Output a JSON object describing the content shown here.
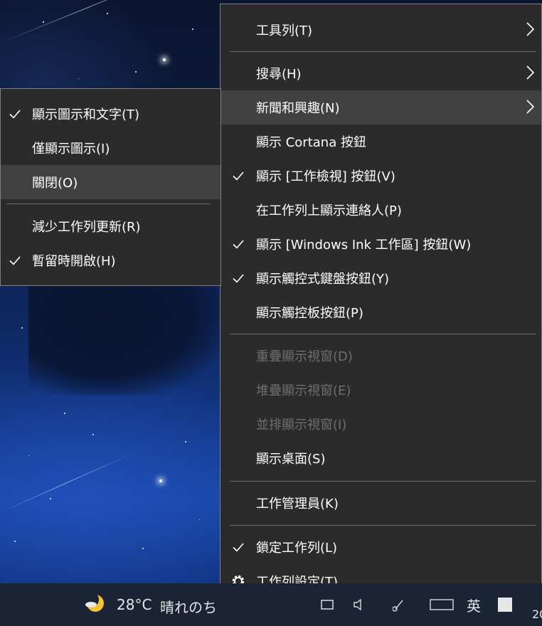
{
  "main_menu": {
    "items": [
      {
        "label": "工具列(T)",
        "checked": false,
        "submenu": true,
        "disabled": false,
        "highlight": false
      },
      {
        "label": "搜尋(H)",
        "checked": false,
        "submenu": true,
        "disabled": false,
        "highlight": false
      },
      {
        "label": "新聞和興趣(N)",
        "checked": false,
        "submenu": true,
        "disabled": false,
        "highlight": true
      },
      {
        "label": "顯示 Cortana 按鈕",
        "checked": false,
        "submenu": false,
        "disabled": false,
        "highlight": false
      },
      {
        "label": "顯示 [工作檢視] 按鈕(V)",
        "checked": true,
        "submenu": false,
        "disabled": false,
        "highlight": false
      },
      {
        "label": "在工作列上顯示連絡人(P)",
        "checked": false,
        "submenu": false,
        "disabled": false,
        "highlight": false
      },
      {
        "label": "顯示 [Windows Ink 工作區] 按鈕(W)",
        "checked": true,
        "submenu": false,
        "disabled": false,
        "highlight": false
      },
      {
        "label": "顯示觸控式鍵盤按鈕(Y)",
        "checked": true,
        "submenu": false,
        "disabled": false,
        "highlight": false
      },
      {
        "label": "顯示觸控板按鈕(P)",
        "checked": false,
        "submenu": false,
        "disabled": false,
        "highlight": false
      },
      {
        "label": "重疊顯示視窗(D)",
        "checked": false,
        "submenu": false,
        "disabled": true,
        "highlight": false
      },
      {
        "label": "堆疊顯示視窗(E)",
        "checked": false,
        "submenu": false,
        "disabled": true,
        "highlight": false
      },
      {
        "label": "並排顯示視窗(I)",
        "checked": false,
        "submenu": false,
        "disabled": true,
        "highlight": false
      },
      {
        "label": "顯示桌面(S)",
        "checked": false,
        "submenu": false,
        "disabled": false,
        "highlight": false
      },
      {
        "label": "工作管理員(K)",
        "checked": false,
        "submenu": false,
        "disabled": false,
        "highlight": false
      },
      {
        "label": "鎖定工作列(L)",
        "checked": true,
        "submenu": false,
        "disabled": false,
        "highlight": false
      },
      {
        "label": "工作列設定(T)",
        "checked": false,
        "submenu": false,
        "disabled": false,
        "highlight": false,
        "icon": "gear-icon"
      }
    ]
  },
  "sub_menu": {
    "items": [
      {
        "label": "顯示圖示和文字(T)",
        "checked": true,
        "highlight": false
      },
      {
        "label": "僅顯示圖示(I)",
        "checked": false,
        "highlight": false
      },
      {
        "label": "關閉(O)",
        "checked": false,
        "highlight": true
      },
      {
        "label": "減少工作列更新(R)",
        "checked": false,
        "highlight": false
      },
      {
        "label": "暫留時開啟(H)",
        "checked": true,
        "highlight": false
      }
    ]
  },
  "taskbar": {
    "weather_icon": "moon-cloud-icon",
    "temperature": "28°C",
    "weather_text": "晴れのち",
    "clock_partial": "20"
  },
  "colors": {
    "menu_bg": "#2b2b2b",
    "menu_highlight": "#414141",
    "menu_border": "#808080",
    "disabled_text": "#6e6e6e",
    "moon": "#f2c230"
  }
}
